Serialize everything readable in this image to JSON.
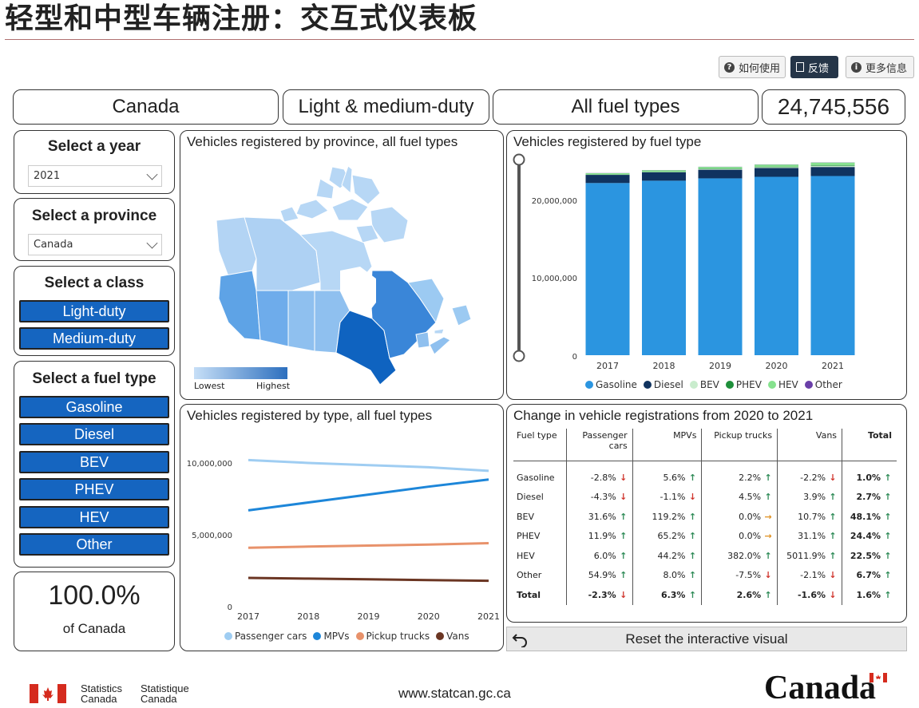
{
  "title": "轻型和中型车辆注册：交互式仪表板",
  "top_buttons": {
    "how_to_use": "如何使用",
    "feedback": "反馈",
    "more_info": "更多信息"
  },
  "summary": {
    "region": "Canada",
    "vehicle_class": "Light & medium-duty",
    "fuel": "All fuel types",
    "total": "24,745,556"
  },
  "filters": {
    "year": {
      "title": "Select a year",
      "value": "2021"
    },
    "province": {
      "title": "Select a province",
      "value": "Canada"
    },
    "vehicle_class": {
      "title": "Select a class",
      "options": [
        "Light-duty",
        "Medium-duty"
      ]
    },
    "fuel_type": {
      "title": "Select a fuel type",
      "options": [
        "Gasoline",
        "Diesel",
        "BEV",
        "PHEV",
        "HEV",
        "Other"
      ]
    }
  },
  "share": {
    "value": "100.0%",
    "label": "of Canada"
  },
  "map_panel": {
    "title": "Vehicles registered by province, all fuel types",
    "legend_low": "Lowest",
    "legend_high": "Highest"
  },
  "fuel_panel": {
    "title": "Vehicles registered by fuel type",
    "y_ticks": [
      "20,000,000",
      "10,000,000",
      "0"
    ],
    "legend": [
      {
        "name": "Gasoline",
        "color": "#2b95e0"
      },
      {
        "name": "Diesel",
        "color": "#10335f"
      },
      {
        "name": "BEV",
        "color": "#c9eccd"
      },
      {
        "name": "PHEV",
        "color": "#1e8f3a"
      },
      {
        "name": "HEV",
        "color": "#86e28e"
      },
      {
        "name": "Other",
        "color": "#6a3fa8"
      }
    ]
  },
  "type_panel": {
    "title": "Vehicles registered by type, all fuel types",
    "y_ticks": [
      "10,000,000",
      "5,000,000",
      "0"
    ],
    "legend": [
      {
        "name": "Passenger cars",
        "color": "#9fcdf2"
      },
      {
        "name": "MPVs",
        "color": "#1d86d9"
      },
      {
        "name": "Pickup trucks",
        "color": "#e8926b"
      },
      {
        "name": "Vans",
        "color": "#6b3623"
      }
    ]
  },
  "change_panel": {
    "title": "Change in vehicle registrations from 2020 to 2021",
    "columns": [
      "Fuel type",
      "Passenger cars",
      "MPVs",
      "Pickup trucks",
      "Vans",
      "Total"
    ],
    "rows": [
      {
        "label": "Gasoline",
        "cells": [
          [
            "-2.8%",
            "down"
          ],
          [
            "5.6%",
            "up"
          ],
          [
            "2.2%",
            "up"
          ],
          [
            "-2.2%",
            "down"
          ],
          [
            "1.0%",
            "up"
          ]
        ]
      },
      {
        "label": "Diesel",
        "cells": [
          [
            "-4.3%",
            "down"
          ],
          [
            "-1.1%",
            "down"
          ],
          [
            "4.5%",
            "up"
          ],
          [
            "3.9%",
            "up"
          ],
          [
            "2.7%",
            "up"
          ]
        ]
      },
      {
        "label": "BEV",
        "cells": [
          [
            "31.6%",
            "up"
          ],
          [
            "119.2%",
            "up"
          ],
          [
            "0.0%",
            "flat"
          ],
          [
            "10.7%",
            "up"
          ],
          [
            "48.1%",
            "up"
          ]
        ]
      },
      {
        "label": "PHEV",
        "cells": [
          [
            "11.9%",
            "up"
          ],
          [
            "65.2%",
            "up"
          ],
          [
            "0.0%",
            "flat"
          ],
          [
            "31.1%",
            "up"
          ],
          [
            "24.4%",
            "up"
          ]
        ]
      },
      {
        "label": "HEV",
        "cells": [
          [
            "6.0%",
            "up"
          ],
          [
            "44.2%",
            "up"
          ],
          [
            "382.0%",
            "up"
          ],
          [
            "5011.9%",
            "up"
          ],
          [
            "22.5%",
            "up"
          ]
        ]
      },
      {
        "label": "Other",
        "cells": [
          [
            "54.9%",
            "up"
          ],
          [
            "8.0%",
            "up"
          ],
          [
            "-7.5%",
            "down"
          ],
          [
            "-2.1%",
            "down"
          ],
          [
            "6.7%",
            "up"
          ]
        ]
      },
      {
        "label": "Total",
        "cells": [
          [
            "-2.3%",
            "down"
          ],
          [
            "6.3%",
            "up"
          ],
          [
            "2.6%",
            "up"
          ],
          [
            "-1.6%",
            "down"
          ],
          [
            "1.6%",
            "up"
          ]
        ]
      }
    ]
  },
  "reset_label": "Reset the interactive visual",
  "footer": {
    "statcan_en_1": "Statistics",
    "statcan_en_2": "Canada",
    "statcan_fr_1": "Statistique",
    "statcan_fr_2": "Canada",
    "url": "www.statcan.gc.ca",
    "wordmark": "Canada"
  },
  "chart_data": [
    {
      "type": "bar",
      "stacked": true,
      "categories": [
        "2017",
        "2018",
        "2019",
        "2020",
        "2021"
      ],
      "ylim": [
        0,
        25000000
      ],
      "series": [
        {
          "name": "Gasoline",
          "values": [
            22100000,
            22400000,
            22700000,
            22900000,
            23000000
          ]
        },
        {
          "name": "Diesel",
          "values": [
            1050000,
            1080000,
            1110000,
            1130000,
            1160000
          ]
        },
        {
          "name": "BEV",
          "values": [
            20000,
            40000,
            80000,
            110000,
            160000
          ]
        },
        {
          "name": "PHEV",
          "values": [
            20000,
            40000,
            60000,
            70000,
            90000
          ]
        },
        {
          "name": "HEV",
          "values": [
            170000,
            190000,
            220000,
            260000,
            320000
          ]
        },
        {
          "name": "Other",
          "values": [
            20000,
            20000,
            20000,
            20000,
            20000
          ]
        }
      ]
    },
    {
      "type": "line",
      "x": [
        "2017",
        "2018",
        "2019",
        "2020",
        "2021"
      ],
      "ylim": [
        0,
        12000000
      ],
      "series": [
        {
          "name": "Passenger cars",
          "values": [
            10200000,
            10000000,
            9850000,
            9700000,
            9450000
          ]
        },
        {
          "name": "MPVs",
          "values": [
            6700000,
            7250000,
            7800000,
            8350000,
            8850000
          ]
        },
        {
          "name": "Pickup trucks",
          "values": [
            4100000,
            4180000,
            4250000,
            4320000,
            4420000
          ]
        },
        {
          "name": "Vans",
          "values": [
            2000000,
            1950000,
            1900000,
            1850000,
            1800000
          ]
        }
      ]
    }
  ]
}
